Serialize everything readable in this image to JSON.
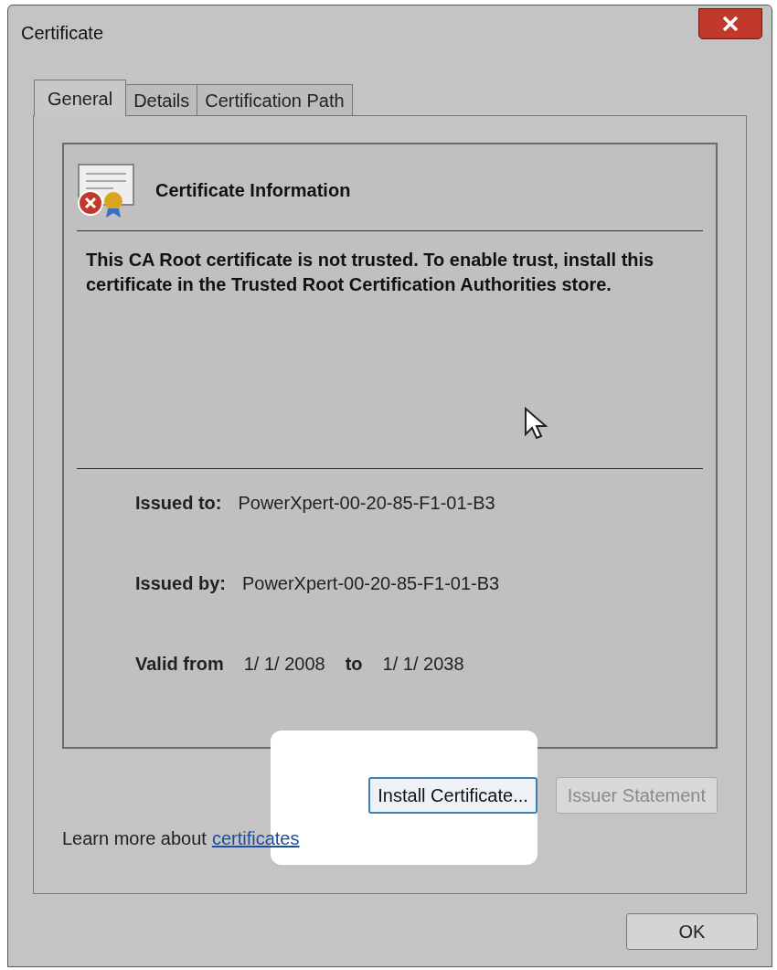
{
  "window": {
    "title": "Certificate"
  },
  "tabs": [
    {
      "label": "General",
      "selected": true
    },
    {
      "label": "Details",
      "selected": false
    },
    {
      "label": "Certification Path",
      "selected": false
    }
  ],
  "info": {
    "heading": "Certificate Information",
    "message": "This CA Root certificate is not trusted. To enable trust, install this certificate in the Trusted Root Certification Authorities store."
  },
  "fields": [
    {
      "label": "Issued to:",
      "value": "PowerXpert-00-20-85-F1-01-B3"
    },
    {
      "label": "Issued by:",
      "value": "PowerXpert-00-20-85-F1-01-B3"
    }
  ],
  "validity": {
    "label": "Valid from",
    "from": "1/ 1/ 2008",
    "to_label": "to",
    "to": "1/ 1/ 2038"
  },
  "buttons": [
    {
      "label": "Install Certificate...",
      "disabled": false
    },
    {
      "label": "Issuer Statement",
      "disabled": true
    }
  ],
  "learn_more": {
    "text": "Learn more about",
    "link": "certificates"
  },
  "ok": "OK"
}
